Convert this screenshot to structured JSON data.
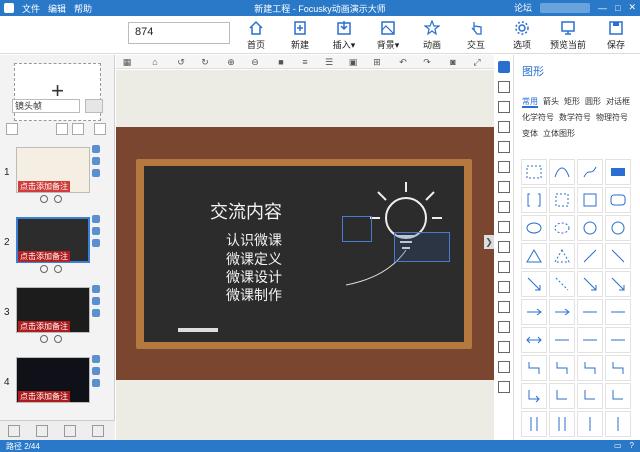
{
  "app": {
    "title": "新建工程 - Focusky动画演示大师",
    "menu": [
      "文件",
      "编辑",
      "帮助"
    ],
    "right_links": {
      "forum": "论坛"
    }
  },
  "toolbar": {
    "search_value": "874",
    "buttons": [
      {
        "label": "首页",
        "icon": "home-icon"
      },
      {
        "label": "新建",
        "icon": "new-file-icon"
      },
      {
        "label": "插入▾",
        "icon": "insert-icon"
      },
      {
        "label": "背景▾",
        "icon": "background-icon"
      },
      {
        "label": "动画",
        "icon": "animation-icon"
      },
      {
        "label": "交互",
        "icon": "interaction-icon"
      },
      {
        "label": "选项",
        "icon": "gear-icon"
      },
      {
        "label": "预览当前",
        "icon": "preview-icon"
      },
      {
        "label": "保存",
        "icon": "save-icon"
      }
    ]
  },
  "left": {
    "camera_select": "镜头帧",
    "slides": [
      {
        "num": "1",
        "note": "点击添加备注"
      },
      {
        "num": "2",
        "note": "点击添加备注"
      },
      {
        "num": "3",
        "note": "点击添加备注"
      },
      {
        "num": "4",
        "note": "点击添加备注"
      }
    ]
  },
  "canvas": {
    "slide_title": "交流内容",
    "items": [
      "认识微课",
      "微课定义",
      "微课设计",
      "微课制作"
    ]
  },
  "panel": {
    "title": "图形",
    "tabs": [
      "常用",
      "箭头",
      "矩形",
      "圆形",
      "对话框",
      "化学符号",
      "数学符号",
      "物理符号",
      "变体",
      "立体图形"
    ],
    "active_tab": "常用"
  },
  "status": {
    "path": "路径 2/44"
  },
  "colors": {
    "accent": "#2a78c8",
    "chalkboard": "#2c2c2c",
    "brick": "#7b4630",
    "frame": "#b5783e"
  }
}
